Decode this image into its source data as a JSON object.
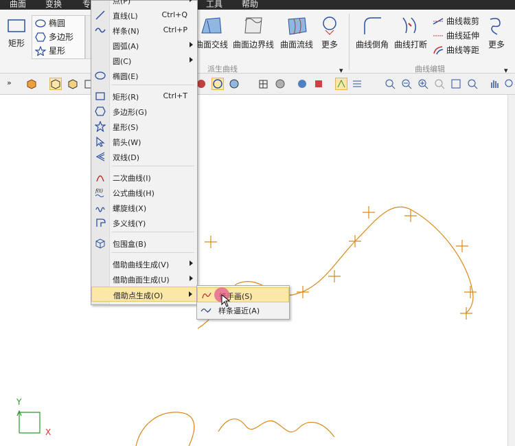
{
  "menubar": {
    "items": [
      "曲面",
      "变换",
      "专",
      "工具",
      "帮助"
    ]
  },
  "ribbon": {
    "rect_label": "矩形",
    "shapes": [
      "椭圆",
      "多边形",
      "星形"
    ],
    "derived_buttons": [
      "曲面交线",
      "曲面边界线",
      "曲面流线",
      "更多"
    ],
    "derived_group_label": "派生曲线",
    "edit_buttons": [
      "曲线倒角",
      "曲线打断"
    ],
    "edit_small": [
      "曲线裁剪",
      "曲线延伸",
      "曲线等距"
    ],
    "edit_more": "更多",
    "edit_group_label": "曲线编辑"
  },
  "menu": {
    "items": [
      {
        "label": "点(P)",
        "shortcut": "",
        "submenu": true
      },
      {
        "label": "直线(L)",
        "shortcut": "Ctrl+Q",
        "submenu": false
      },
      {
        "label": "样条(N)",
        "shortcut": "Ctrl+P",
        "submenu": false
      },
      {
        "label": "圆弧(A)",
        "shortcut": "",
        "submenu": true
      },
      {
        "label": "圆(C)",
        "shortcut": "",
        "submenu": true
      },
      {
        "label": "椭圆(E)",
        "shortcut": "",
        "submenu": false
      },
      {
        "label": "矩形(R)",
        "shortcut": "Ctrl+T",
        "submenu": false
      },
      {
        "label": "多边形(G)",
        "shortcut": "",
        "submenu": false
      },
      {
        "label": "星形(S)",
        "shortcut": "",
        "submenu": false
      },
      {
        "label": "箭头(W)",
        "shortcut": "",
        "submenu": false
      },
      {
        "label": "双线(D)",
        "shortcut": "",
        "submenu": false
      },
      {
        "label": "二次曲线(I)",
        "shortcut": "",
        "submenu": false
      },
      {
        "label": "公式曲线(H)",
        "shortcut": "",
        "submenu": false
      },
      {
        "label": "螺旋线(X)",
        "shortcut": "",
        "submenu": false
      },
      {
        "label": "多义线(Y)",
        "shortcut": "",
        "submenu": false
      },
      {
        "label": "包围盒(B)",
        "shortcut": "",
        "submenu": false
      },
      {
        "label": "借助曲线生成(V)",
        "shortcut": "",
        "submenu": true
      },
      {
        "label": "借助曲面生成(U)",
        "shortcut": "",
        "submenu": true
      },
      {
        "label": "借助点生成(O)",
        "shortcut": "",
        "submenu": true
      }
    ]
  },
  "submenu": {
    "items": [
      {
        "label": "徒手画(S)"
      },
      {
        "label": "样条逼近(A)"
      }
    ]
  },
  "axis": {
    "x_label": "X",
    "y_label": "Y"
  },
  "colors": {
    "curve": "#d9891b",
    "axis_x": "#e03030",
    "axis_y": "#2a9a2a",
    "highlight": "#fbe8a8"
  }
}
